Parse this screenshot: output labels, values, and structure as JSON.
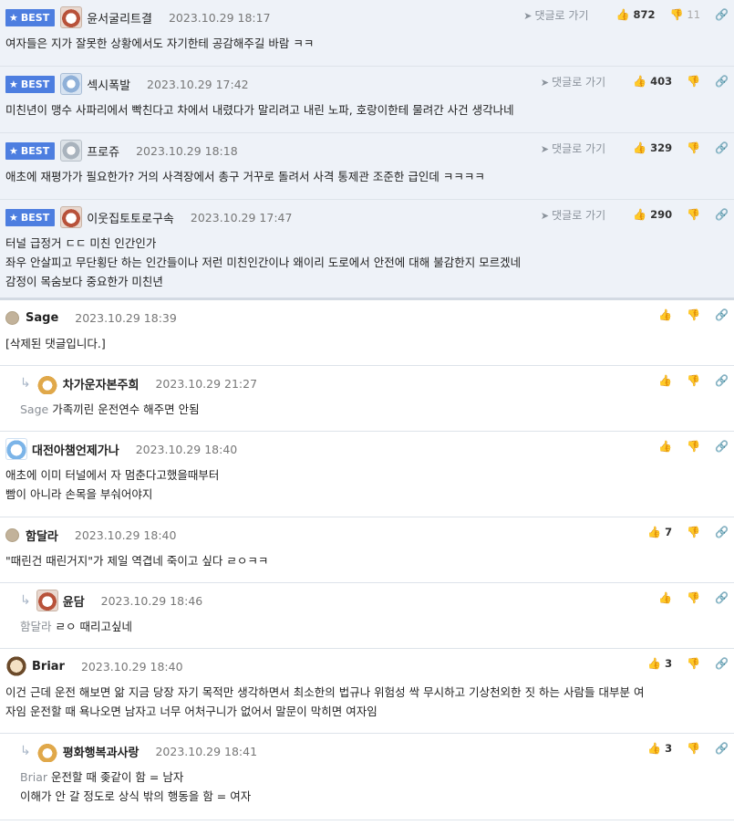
{
  "ui": {
    "best_label": "BEST",
    "goto_label": "댓글로 가기"
  },
  "best": [
    {
      "name": "윤서굴리트결",
      "date": "2023.10.29 18:17",
      "up": "872",
      "down": "11",
      "lines": [
        "여자들은 지가 잘못한 상황에서도 자기한테 공감해주길 바람 ㅋㅋ"
      ]
    },
    {
      "name": "섹시폭발",
      "date": "2023.10.29 17:42",
      "up": "403",
      "down": "",
      "lines": [
        "미친년이 맹수 사파리에서 빡친다고 차에서 내렸다가 말리려고 내린 노파, 호랑이한테 물려간 사건 생각나네"
      ]
    },
    {
      "name": "프로쥬",
      "date": "2023.10.29 18:18",
      "up": "329",
      "down": "",
      "lines": [
        "애초에 재평가가 필요한가? 거의 사격장에서 총구 거꾸로 돌려서 사격 통제관 조준한 급인데 ㅋㅋㅋㅋ"
      ]
    },
    {
      "name": "이웃집토토로구속",
      "date": "2023.10.29 17:47",
      "up": "290",
      "down": "",
      "lines": [
        "터널 급정거 ㄷㄷ 미친 인간인가",
        "좌우 안살피고 무단횡단 하는 인간들이나 저런 미친인간이나 왜이리 도로에서 안전에 대해 불감한지 모르겠네",
        "감정이 목숨보다 중요한가 미친년"
      ]
    }
  ],
  "comments": [
    {
      "name": "Sage",
      "date": "2023.10.29 18:39",
      "up": "",
      "ref": "",
      "lines": [
        "[삭제된 댓글입니다.]"
      ]
    },
    {
      "name": "차가운자본주희",
      "date": "2023.10.29 21:27",
      "up": "",
      "ref": "Sage",
      "lines": [
        "가족끼린 운전연수 해주면 안됨"
      ]
    },
    {
      "name": "대전아챔언제가나",
      "date": "2023.10.29 18:40",
      "up": "",
      "ref": "",
      "lines": [
        "애초에 이미 터널에서 자 멈춘다고했을때부터",
        "빰이 아니라 손목을 부숴어야지"
      ]
    },
    {
      "name": "함달라",
      "date": "2023.10.29 18:40",
      "up": "7",
      "ref": "",
      "lines": [
        "\"때린건 때린거지\"가 제일 역겹네 죽이고 싶다 ㄹㅇㅋㅋ"
      ]
    },
    {
      "name": "윤담",
      "date": "2023.10.29 18:46",
      "up": "",
      "ref": "함달라",
      "lines": [
        "ㄹㅇ 때리고싶네"
      ]
    },
    {
      "name": "Briar",
      "date": "2023.10.29 18:40",
      "up": "3",
      "ref": "",
      "lines": [
        "이건 근데 운전 해보면 앎 지금 당장 자기 목적만 생각하면서 최소한의 법규나 위험성 싹 무시하고 기상천외한 짓 하는 사람들 대부분 여",
        "자임 운전할 때 욕나오면 남자고 너무 어처구니가 없어서 말문이 막히면 여자임"
      ]
    },
    {
      "name": "평화행복과사랑",
      "date": "2023.10.29 18:41",
      "up": "3",
      "ref": "Briar",
      "lines": [
        "운전할 때 좆같이 함 = 남자",
        "이해가 안 갈 정도로 상식 밖의 행동을 함 = 여자"
      ]
    }
  ],
  "icons": {
    "thumb_up": "thumbs-up-icon",
    "thumb_down": "thumbs-down-icon",
    "link": "link-icon",
    "goto": "send-arrow-icon",
    "star": "star-icon",
    "reply": "reply-arrow-icon"
  },
  "colors": {
    "best_badge": "#4d7ee0",
    "best_bg": "#eef2f8"
  }
}
